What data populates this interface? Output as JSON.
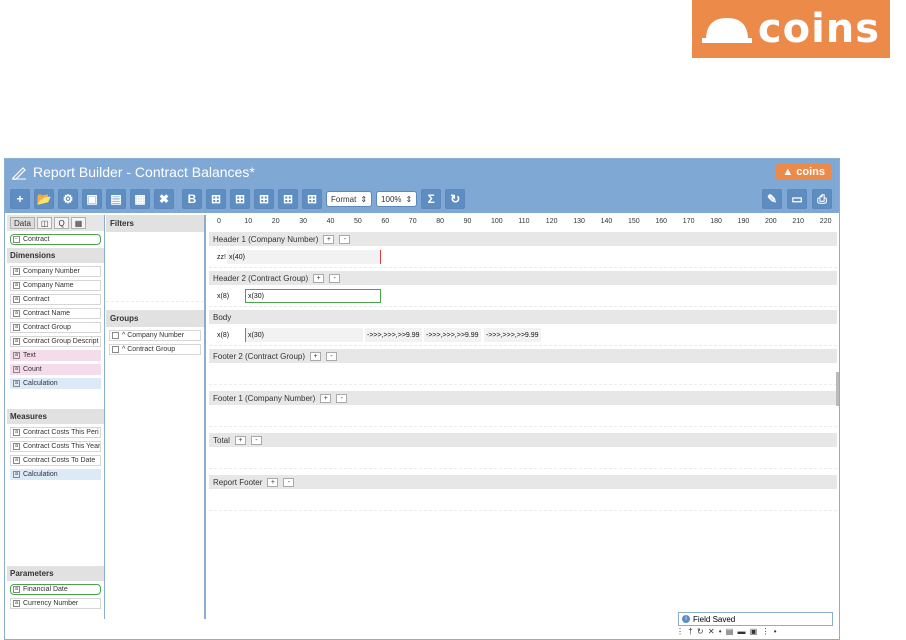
{
  "brand": {
    "logo_text": "coins"
  },
  "window": {
    "title": "Report Builder - Contract Balances*",
    "small_logo": "coins"
  },
  "toolbar": {
    "format_label": "Format",
    "zoom_label": "100%"
  },
  "data_panel": {
    "tabs": [
      "Data",
      "",
      "Q",
      ""
    ],
    "selected_table": "Contract",
    "dimensions_label": "Dimensions",
    "dimensions": [
      {
        "label": "Company Number",
        "style": "plain"
      },
      {
        "label": "Company Name",
        "style": "plain"
      },
      {
        "label": "Contract",
        "style": "plain"
      },
      {
        "label": "Contract Name",
        "style": "plain"
      },
      {
        "label": "Contract Group",
        "style": "plain"
      },
      {
        "label": "Contract Group Descript",
        "style": "plain"
      },
      {
        "label": "Text",
        "style": "pink"
      },
      {
        "label": "Count",
        "style": "pink"
      },
      {
        "label": "Calculation",
        "style": "blue"
      }
    ],
    "measures_label": "Measures",
    "measures": [
      {
        "label": "Contract Costs This Peri",
        "style": "plain"
      },
      {
        "label": "Contract Costs This Year",
        "style": "plain"
      },
      {
        "label": "Contract Costs To Date",
        "style": "plain"
      },
      {
        "label": "Calculation",
        "style": "blue"
      }
    ],
    "parameters_label": "Parameters",
    "parameters": [
      {
        "label": "Financial Date",
        "style": "green"
      },
      {
        "label": "Currency Number",
        "style": "plain"
      }
    ]
  },
  "groups_panel": {
    "filters_label": "Filters",
    "groups_label": "Groups",
    "groups": [
      "^ Company Number",
      "^ Contract Group"
    ]
  },
  "canvas": {
    "ruler": [
      "0",
      "10",
      "20",
      "30",
      "40",
      "50",
      "60",
      "70",
      "80",
      "90",
      "100",
      "110",
      "120",
      "130",
      "140",
      "150",
      "160",
      "170",
      "180",
      "190",
      "200",
      "210",
      "220"
    ],
    "bands": {
      "header1": "Header 1 (Company Number)",
      "header2": "Header 2 (Contract Group)",
      "body": "Body",
      "footer2": "Footer 2 (Contract Group)",
      "footer1": "Footer 1 (Company Number)",
      "total": "Total",
      "report_footer": "Report Footer"
    },
    "plus": "+",
    "minus": "-",
    "fields": {
      "h1_a": "zz!",
      "h1_b": "x(40)",
      "h2_a": "x(8)",
      "h2_b": "x(30)",
      "b_a": "x(8)",
      "b_b": "x(30)",
      "b_c": "->>>,>>>,>>9.99",
      "b_d": "->>>,>>>,>>9.99",
      "b_e": "->>>,>>>,>>9.99"
    }
  },
  "status": {
    "message": "Field Saved"
  },
  "colors": {
    "frame": "#7fa8d4",
    "brand_orange": "#ec8a4a"
  }
}
